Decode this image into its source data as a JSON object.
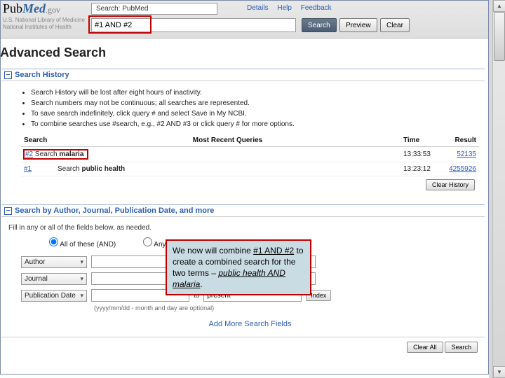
{
  "logo": {
    "pub": "Pub",
    "med": "Med",
    "gov": ".gov"
  },
  "subhead": {
    "line1": "U.S. National Library of Medicine",
    "line2": "National Institutes of Health"
  },
  "search_scope": "Search: PubMed",
  "toplinks": {
    "details": "Details",
    "help": "Help",
    "feedback": "Feedback"
  },
  "search_value": "#1 AND #2",
  "buttons": {
    "search": "Search",
    "preview": "Preview",
    "clear": "Clear",
    "clear_history": "Clear History",
    "clear_all": "Clear All",
    "index": "Index"
  },
  "adv_title": "Advanced Search",
  "panel_history": {
    "title": "Search History",
    "tips": [
      "Search History will be lost after eight hours of inactivity.",
      "Search numbers may not be continuous; all searches are represented.",
      "To save search indefinitely, click query # and select Save in My NCBI.",
      "To combine searches use #search, e.g., #2 AND #3 or click query # for more options."
    ],
    "cols": {
      "search": "Search",
      "queries": "Most Recent Queries",
      "time": "Time",
      "result": "Result"
    },
    "rows": [
      {
        "id": "#2",
        "prefix": "Search ",
        "term": "malaria",
        "time": "13:33:53",
        "result": "52135",
        "hl": true
      },
      {
        "id": "#1",
        "prefix": "Search ",
        "term": "public health",
        "time": "13:23:12",
        "result": "4255926",
        "hl": false
      }
    ]
  },
  "panel_filters": {
    "title": "Search by Author, Journal, Publication Date, and more",
    "hint": "Fill in any or all of the fields below, as needed.",
    "radio_all": "All of these (AND)",
    "radio_any": "Any of these (OR)",
    "author_label": "Author",
    "journal_label": "Journal",
    "pubdate_label": "Publication Date",
    "to": "to",
    "date_to_value": "present",
    "date_hint": "(yyyy/mm/dd - month and day are optional)",
    "add_more": "Add More Search Fields"
  },
  "callout": {
    "t1": "We now will combine ",
    "u1": "#1 AND #2",
    "t2": " to create a combined search for the two terms – ",
    "u2": "public health AND malaria",
    "t3": "."
  }
}
